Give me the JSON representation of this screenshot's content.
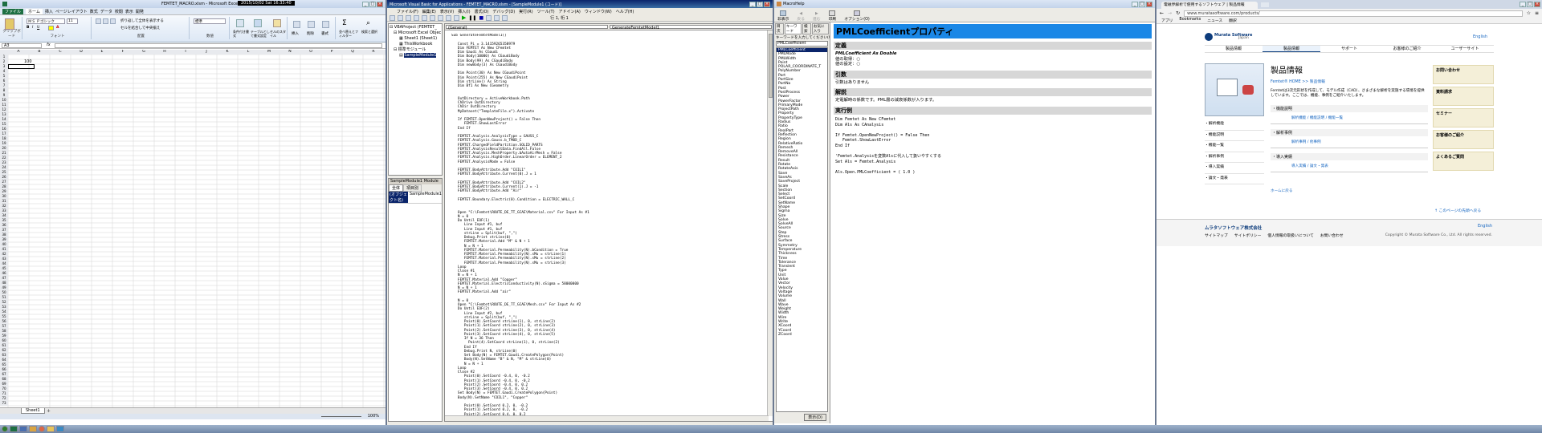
{
  "excel": {
    "title": "FEMTET_MACRO.xlsm - Microsoft Excel",
    "clock": "2015/10/02 Sat 16:33:40",
    "tabs": [
      "ファイル",
      "ホーム",
      "挿入",
      "ページレイアウト",
      "数式",
      "データ",
      "校閲",
      "表示",
      "開発"
    ],
    "font_name": "ＭＳ Ｐゴシック",
    "font_size": "11",
    "ribbon_groups": [
      "クリップボード",
      "フォント",
      "配置",
      "数値",
      "スタイル",
      "セル",
      "編集"
    ],
    "wrap_label": "折り返して全体を表示する",
    "merge_label": "セルを結合して中央揃え",
    "number_format": "標準",
    "cond_format": "条件付き書式",
    "table_format": "テーブルとして書式設定",
    "cell_style": "セルのスタイル",
    "insert": "挿入",
    "delete": "削除",
    "format": "書式",
    "sort": "並べ替えとフィルター",
    "find": "検索と選択",
    "name_box": "A3",
    "columns": [
      "A",
      "B",
      "C",
      "D",
      "E",
      "F",
      "G",
      "H",
      "I",
      "J",
      "K",
      "L",
      "M",
      "N",
      "O",
      "P",
      "Q",
      "R"
    ],
    "cell_b2": "100",
    "sheet_tab": "Sheet1",
    "zoom": "100%"
  },
  "vbe": {
    "title": "Microsoft Visual Basic for Applications - FEMTET_MACRO.xlsm - [SampleModule1 (コード)]",
    "menus": [
      "ファイル(F)",
      "編集(E)",
      "表示(V)",
      "挿入(I)",
      "書式(O)",
      "デバッグ(D)",
      "実行(R)",
      "ツール(T)",
      "アドイン(A)",
      "ウィンドウ(W)",
      "ヘルプ(H)"
    ],
    "position": "行 1, 桁 1",
    "tree": [
      "VBAProject (FEMTET_",
      "Microsoft Excel Objec",
      "Sheet1 (Sheet1)",
      "ThisWorkbook",
      "標準モジュール",
      "SampleModule1"
    ],
    "props_title": "SampleModule1 Module",
    "props_tabs": [
      "全体",
      "項目別"
    ],
    "prop_name": "(オブジェクト名)",
    "prop_value": "SampleModule1",
    "combo_left": "(General)",
    "combo_right": "GenerateFemtetModel1",
    "code": "Sub GenerateFemtetModel1()\n\n   Const Pi = 3.14159265358979\n   Dim FEMTET As New CFemtet\n   Dim Gaudi As CGaudi\n   Dim Body(10000) As CGaudiBody\n   Dim Body(99) As CGaudiBody\n   Dim newBody(3) As CGaudiBody\n\n   Dim Point(30) As New CGaudiPoint\n   Dim Point(255) As New CGaudiPoint\n   Dim strLine() As String\n   Dim Bf1 As New CGeometry\n\n\n   OutDirectory = ActiveWorkbook.Path\n   ChDrive OutDirectory\n   ChDir OutDirectory\n   MyDataset(\"TemplateFile.x\").Activate\n\n   If FEMTET.OpenNewProject() = False Then\n      FEMTET.ShowLastError\n   End If\n\n   FEMTET.Analysis.AnalysisType = GAUSS_C\n   FEMTET.Analysis.Gauss.b_TMOD_C\n   FEMTET.ChargedFieldPartition.SOLID_PARTS\n   FEMTET.AnalysisResultData.FindAll.False\n   FEMTET.Analysis.MeshProperty.bAutoAirMesh = False\n   FEMTET.Analysis.HighOrder.LinearOrder = ELEMENT_2\n   FEMTET.AnalysisMode = False\n\n   FEMTET.BodyAttribute.Add \"COIL1\"\n   FEMTET.BodyAttribute.Current(0).J = 1\n\n   FEMTET.BodyAttribute.Add \"COIL2\"\n   FEMTET.BodyAttribute.Current(1).J = -1\n   FEMTET.BodyAttribute.Add \"Air\"\n\n   FEMTET.Boundary.Electric(0).Condition = ELECTRIC_WALL_C\n\n\n   Open \"C:\\Femtet\\ROUTE_DE_TT_GCAE\\Material.csv\" For Input As #1\n   N = 0\n   Do Until EOF(1)\n      Line Input #1, buf\n      Line Input #1, buf\n      strLine = Split(buf, \",\")\n      Debug.Print strLine(0)\n      FEMTET.Material.Add \"M\" & N + 1\n      N = N + 1\n      FEMTET.Material.Permeability(N).bCondition = True\n      FEMTET.Material.Permeability(N).sMu = strLine(1)\n      FEMTET.Material.Permeability(N).sMu = strLine(2)\n      FEMTET.Material.Permeability(N).sMu = strLine(3)\n   Loop\n   Close #1\n   N = N + 1\n   FEMTET.Material.Add \"Copper\"\n   FEMTET.Material.ElectricConductivity(N).sSigma = 58000000\n   N = N + 1\n   FEMTET.Material.Add \"air\"\n\n   N = 0\n   Open \"C:\\Femtet\\ROUTE_DE_TT_GCAE\\Mesh.csv\" For Input As #2\n   Do Until EOF(2)\n      Line Input #2, buf\n      strLine = Split(buf, \",\")\n      Point(0).SetCoord strLine(1), 0, strLine(2)\n      Point(1).SetCoord strLine(2), 0, strLine(3)\n      Point(2).SetCoord strLine(3), 0, strLine(4)\n      Point(3).SetCoord strLine(4), 0, strLine(5)\n      If N = 36 Then\n        Point(4).SetCoord strLine(1), 0, strLine(2)\n      End If\n      Debug.Print N, strLine(0)\n      Set Body(N) = FEMTET.Gaudi.CreatePolygon(Point)\n      Body(N).SetName \"B\" & N, \"M\" & strLine(0)\n      N = N + 1\n   Loop\n   Close #2\n      Point(0).SetCoord -0.4, 0, -0.2\n      Point(1).SetCoord -0.4, 0, -0.2\n      Point(2).SetCoord -0.4, 0, 0.2\n      Point(3).SetCoord -0.4, 0, 0.2\n   Set Body(N) = FEMTET.Gaudi.CreatePolygon(Point)\n   Body(N).SetName \"COIL1\", \"Copper\"\n\n      Point(0).SetCoord 0.2, 0, -0.2\n      Point(1).SetCoord 0.2, 0, -0.2\n      Point(2).SetCoord 0.4, 0, 0.2\n      Point(3).SetCoord 0.4, 0, 0.2\n   Set Body(N) = FEMTET.Gaudi.CreatePolygon(Point)\n   Body(N).SetName \"COIL2\", \"Copper\""
  },
  "macro_help": {
    "window_title": "MacroHelp",
    "toolbar": [
      "非表示",
      "戻る",
      "進む",
      "印刷",
      "オプション(O)"
    ],
    "index_tabs": [
      "目次",
      "キーワード",
      "検索",
      "お気に入り"
    ],
    "keyword_label": "キーワードを入力してください(W)",
    "keyword_value": "PMLCoefficient",
    "display_button": "表示(D)",
    "list": [
      "PMLCoefficient",
      "PMLMode",
      "PMLWidth",
      "Point",
      "POLAR_COORDINATE_T",
      "PolyNumber",
      "Port",
      "PortSize",
      "PortNo",
      "Post",
      "PostProcess",
      "Power",
      "PowerFactor",
      "PrimaryMode",
      "ProjectPath",
      "Property",
      "PropertyType",
      "Radius",
      "Ratio",
      "RealPart",
      "Reflection",
      "Region",
      "RelativeRatio",
      "Remesh",
      "RemoveAll",
      "Resistance",
      "Result",
      "Rotate",
      "RotateAxis",
      "Save",
      "SaveAs",
      "SaveProject",
      "Scale",
      "Section",
      "Select",
      "SetCoord",
      "SetName",
      "Shape",
      "Sigma",
      "Size",
      "Solve",
      "SolveAll",
      "Source",
      "Step",
      "Stress",
      "Surface",
      "Symmetry",
      "Temperature",
      "Thickness",
      "Time",
      "Tolerance",
      "Transient",
      "Type",
      "Unit",
      "Value",
      "Vector",
      "Velocity",
      "Voltage",
      "Volume",
      "Wall",
      "Wave",
      "Weight",
      "Width",
      "Wire",
      "Write",
      "XCoord",
      "YCoord",
      "ZCoord"
    ],
    "page_title": "PMLCoefficientプロパティ",
    "sec_def": "定義",
    "def_signature": "PMLCoefficient As Double",
    "def_get": "値の取得：○",
    "def_set": "値の設定：○",
    "sec_args": "引数",
    "args_text": "引数はありません",
    "sec_desc": "解説",
    "desc_text": "定電解時の係数です。PML層の減衰係数が入ります。",
    "sec_example": "実行例",
    "example": "Dim Femtet As New CFemtet\nDim Als As CAnalysis\n\nIf Femtet.OpenNewProject() = False Then\n   Femtet.ShowLastError\nEnd If\n\n'Femtet.Analysisを変数Alsに代入して扱いやすくする\nSet Als = Femtet.Analysis\n\nAls.Open.PMLCoefficient = ( 1.0 )"
  },
  "browser": {
    "tab_title": "電磁界解析で使用するソフトウェア | 製品情報",
    "url": "www.muratasoftware.com/products/",
    "bookmarks": [
      "アプリ",
      "Bookmarks",
      "ニュース",
      "翻訳"
    ],
    "logo": "Murata Software",
    "lang": "Japan",
    "english_link": "English",
    "nav": [
      "製品情報",
      "製品情報",
      "サポート",
      "お客様のご紹介",
      "ユーザーサイト"
    ],
    "heading": "製品情報",
    "breadcrumb": "Femtet® HOME >> 製品情報",
    "intro": "Femtetは3次元形状を作成して、モデル作成（CAD）、さまざまな解析を実施する環境を提供しています。ここでは、機能、事例をご紹介いたします。",
    "left_menu": [
      "・解析機能",
      "・機能説明",
      "・機能一覧",
      "・解析事例",
      "・導入実績",
      "・論文・発表"
    ],
    "feature_head": "・機能説明",
    "feature_link": "解析機能 / 機能説明 / 機能一覧",
    "case_head": "・解析事例",
    "case_link": "解析事例 / 他事例",
    "adopt_head": "・導入実績",
    "adopt_link": "導入実績 / 論文・発表",
    "side_boxes": [
      "お問い合わせ",
      "資料請求",
      "セミナー",
      "お客様のご紹介",
      "よくあるご質問"
    ],
    "page_top": "↑ このページの先頭へ戻る",
    "home_link": "ホームに戻る",
    "footer_logo": "ムラタソフトウェア株式会社",
    "footer_links": [
      "サイトマップ",
      "サイトポリシー",
      "個人情報の取扱いについて",
      "お問い合わせ"
    ],
    "footer_english": "English",
    "copyright": "Copyright © Murata Software Co., Ltd. All rights reserved."
  },
  "colors": {
    "code_keyword": "#000080",
    "help_title_bar": "#1a87e6",
    "excel_select": "#ffff00",
    "browser_blue": "#1565c0",
    "browser_nav": "#0d3c7c"
  },
  "taskbar": {
    "items": [
      "start",
      "excel",
      "vbe",
      "help",
      "chrome",
      "folder",
      "femtet"
    ]
  }
}
